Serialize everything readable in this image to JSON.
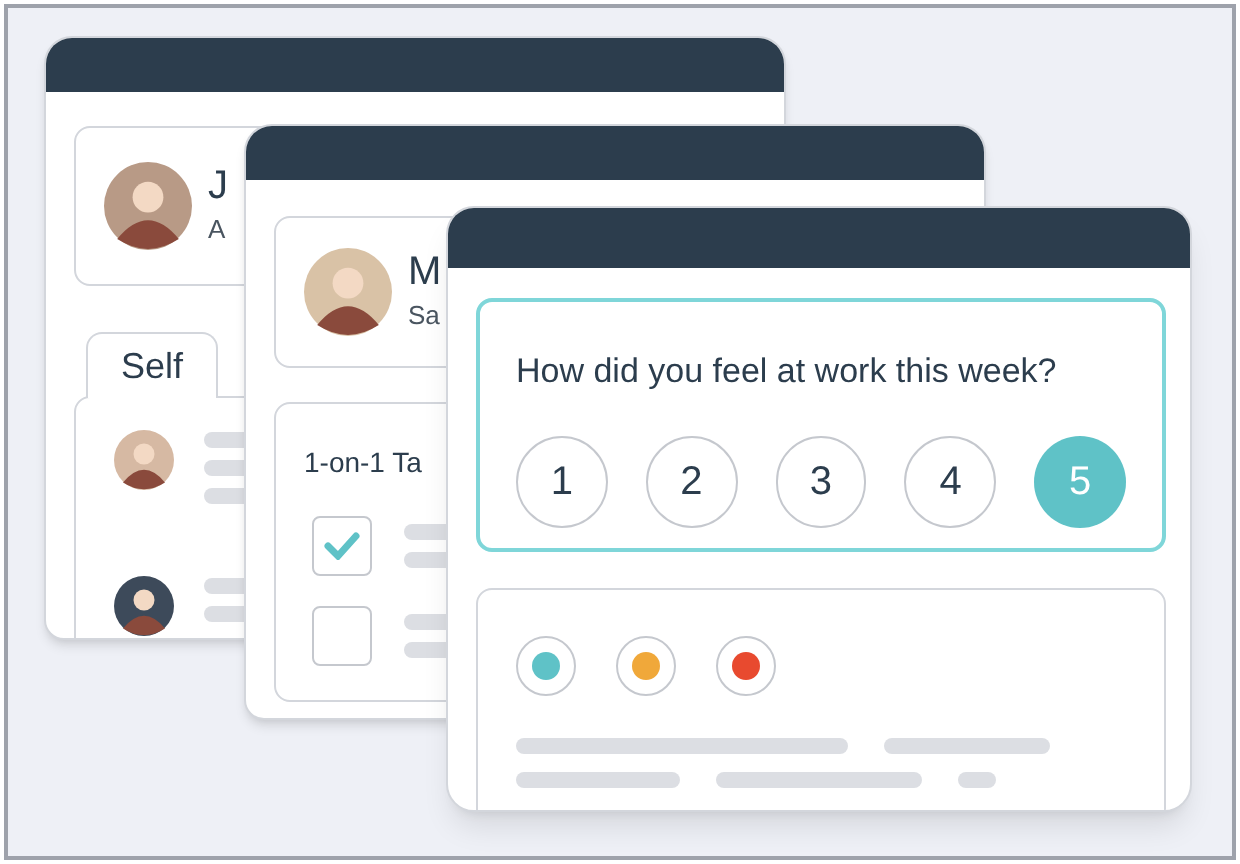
{
  "back_window": {
    "profile": {
      "name": "J",
      "subtitle": "A"
    },
    "tab": {
      "label": "Self",
      "selected": true
    }
  },
  "middle_window": {
    "profile": {
      "name": "M",
      "subtitle": "Sa"
    },
    "tasks_card": {
      "title": "1-on-1 Ta",
      "tasks": [
        {
          "checked": true
        },
        {
          "checked": false
        }
      ]
    }
  },
  "front_window": {
    "question": "How did you feel at work this week?",
    "ratings": [
      {
        "label": "1",
        "selected": false
      },
      {
        "label": "2",
        "selected": false
      },
      {
        "label": "3",
        "selected": false
      },
      {
        "label": "4",
        "selected": false
      },
      {
        "label": "5",
        "selected": true
      }
    ],
    "mood_dots": [
      {
        "color": "#5fc2c7"
      },
      {
        "color": "#f0a83a"
      },
      {
        "color": "#e84a2f"
      }
    ]
  }
}
